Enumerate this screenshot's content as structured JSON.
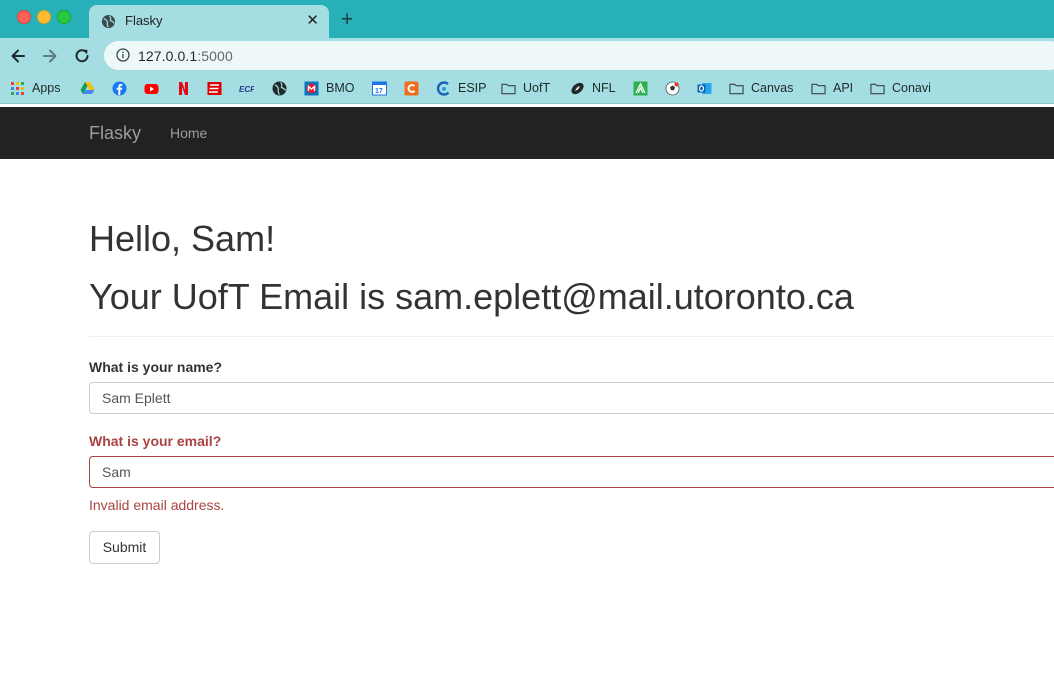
{
  "browser": {
    "tab_title": "Flasky",
    "url_host": "127.0.0.1",
    "url_port": ":5000",
    "bookmarks": [
      {
        "label": "Apps",
        "icon": "apps-grid-icon"
      },
      {
        "label": "",
        "icon": "google-drive-icon"
      },
      {
        "label": "",
        "icon": "facebook-icon"
      },
      {
        "label": "",
        "icon": "youtube-icon"
      },
      {
        "label": "",
        "icon": "netflix-icon"
      },
      {
        "label": "",
        "icon": "espn-icon"
      },
      {
        "label": "",
        "icon": "ecf-icon"
      },
      {
        "label": "",
        "icon": "globe-icon"
      },
      {
        "label": "BMO",
        "icon": "bmo-icon"
      },
      {
        "label": "",
        "icon": "calendar-icon"
      },
      {
        "label": "",
        "icon": "c-icon"
      },
      {
        "label": "ESIP",
        "icon": "esip-icon"
      },
      {
        "label": "UofT",
        "icon": "folder-icon"
      },
      {
        "label": "NFL",
        "icon": "football-icon"
      },
      {
        "label": "",
        "icon": "feedly-icon"
      },
      {
        "label": "",
        "icon": "soccer-icon"
      },
      {
        "label": "",
        "icon": "outlook-icon"
      },
      {
        "label": "Canvas",
        "icon": "folder-icon"
      },
      {
        "label": "API",
        "icon": "folder-icon"
      },
      {
        "label": "Conavi",
        "icon": "folder-icon"
      }
    ]
  },
  "navbar": {
    "brand": "Flasky",
    "home": "Home"
  },
  "page": {
    "greeting": "Hello, Sam!",
    "email_heading": "Your UofT Email is sam.eplett@mail.utoronto.ca"
  },
  "form": {
    "name_label": "What is your name?",
    "name_value": "Sam Eplett",
    "email_label": "What is your email?",
    "email_value": "Sam",
    "email_error": "Invalid email address.",
    "submit_label": "Submit"
  },
  "colors": {
    "tab_bar": "#27b0b7",
    "toolbar": "#a4dde2",
    "navbar": "#222222",
    "error": "#a94442"
  }
}
